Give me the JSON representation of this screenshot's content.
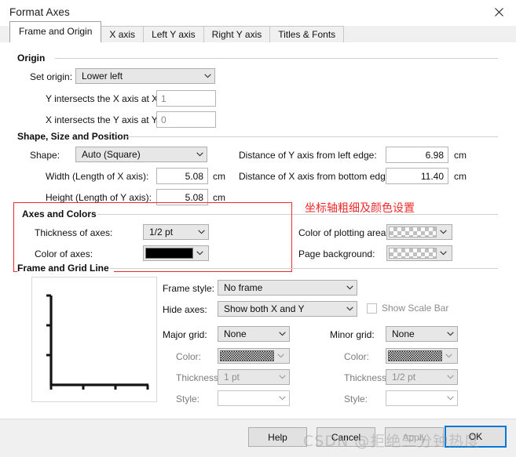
{
  "window": {
    "title": "Format Axes",
    "close_icon": "close-icon"
  },
  "tabs": [
    {
      "label": "Frame and Origin",
      "active": true
    },
    {
      "label": "X axis",
      "active": false
    },
    {
      "label": "Left Y axis",
      "active": false
    },
    {
      "label": "Right Y axis",
      "active": false
    },
    {
      "label": "Titles & Fonts",
      "active": false
    }
  ],
  "origin": {
    "group_label": "Origin",
    "set_origin_label": "Set origin:",
    "set_origin_value": "Lower left",
    "y_intersect_label": "Y intersects the X axis at X=",
    "y_intersect_value": "1",
    "x_intersect_label": "X intersects the Y axis at Y=",
    "x_intersect_value": "0"
  },
  "shape": {
    "group_label": "Shape, Size and Position",
    "shape_label": "Shape:",
    "shape_value": "Auto (Square)",
    "width_label": "Width (Length of X axis):",
    "width_value": "5.08",
    "width_unit": "cm",
    "height_label": "Height (Length of Y axis):",
    "height_value": "5.08",
    "height_unit": "cm",
    "dist_y_label": "Distance of Y axis from left edge:",
    "dist_y_value": "6.98",
    "dist_y_unit": "cm",
    "dist_x_label": "Distance of X axis from bottom edge:",
    "dist_x_value": "11.40",
    "dist_x_unit": "cm"
  },
  "axes_colors": {
    "group_label": "Axes and Colors",
    "thickness_label": "Thickness of axes:",
    "thickness_value": "1/2 pt",
    "color_label": "Color of axes:",
    "color_value": "#000000",
    "plot_area_label": "Color of plotting area:",
    "plot_area_value": "transparent",
    "page_bg_label": "Page background:",
    "page_bg_value": "transparent"
  },
  "frame_grid": {
    "group_label": "Frame and Grid Line",
    "frame_style_label": "Frame style:",
    "frame_style_value": "No frame",
    "hide_axes_label": "Hide axes:",
    "hide_axes_value": "Show both X and Y",
    "show_scale_bar_label": "Show Scale Bar",
    "show_scale_bar_checked": false,
    "major_grid_label": "Major grid:",
    "major_grid_value": "None",
    "major_color_label": "Color:",
    "major_thickness_label": "Thickness:",
    "major_thickness_value": "1 pt",
    "major_style_label": "Style:",
    "major_style_value": "",
    "minor_grid_label": "Minor grid:",
    "minor_grid_value": "None",
    "minor_color_label": "Color:",
    "minor_thickness_label": "Thickness:",
    "minor_thickness_value": "1/2 pt",
    "minor_style_label": "Style:",
    "minor_style_value": ""
  },
  "annotation": {
    "text": "坐标轴粗细及颜色设置",
    "color": "#ef2b2b"
  },
  "footer": {
    "help": "Help",
    "cancel": "Cancel",
    "apply": "Apply",
    "ok": "OK"
  },
  "watermark": {
    "text": "CSDN @拒绝三分钟热度"
  }
}
